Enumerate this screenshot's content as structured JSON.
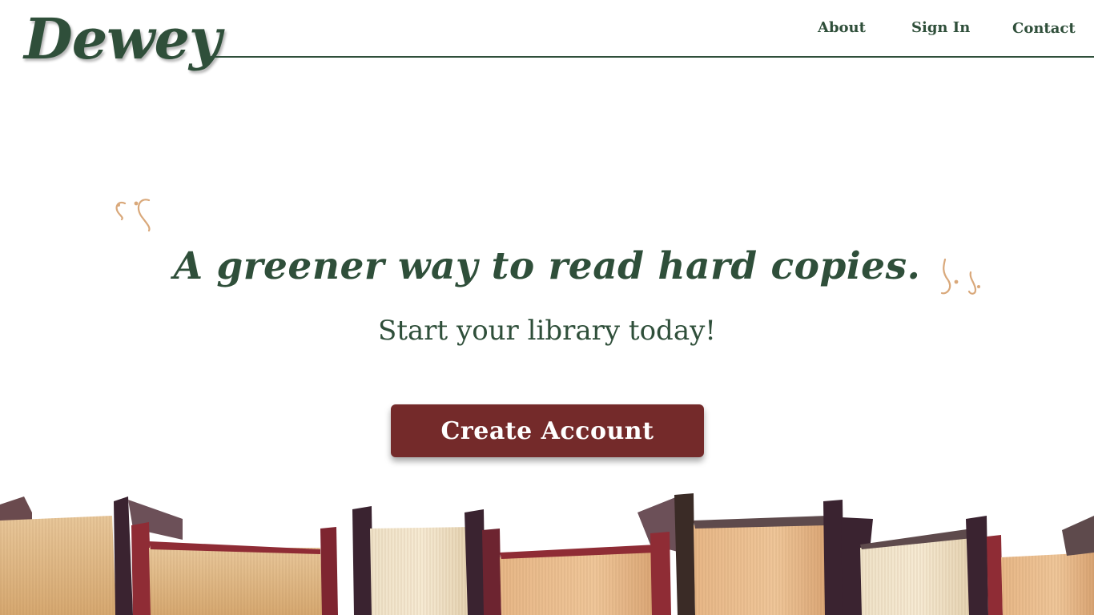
{
  "brand": {
    "logo_text": "Dewey"
  },
  "nav": {
    "about_label": "About",
    "signin_label": "Sign In",
    "contact_label": "Contact"
  },
  "hero": {
    "headline": "A greener way to read hard copies.",
    "subheadline": "Start your library today!",
    "cta_label": "Create Account"
  },
  "colors": {
    "brand_green": "#2f4f3a",
    "cta_red": "#742a2a",
    "quote_accent": "#d9a87a"
  },
  "decorations": {
    "quote_open_icon": "opening-quote-icon",
    "quote_close_icon": "closing-quote-icon",
    "banner_image": "book-spines-photo"
  }
}
